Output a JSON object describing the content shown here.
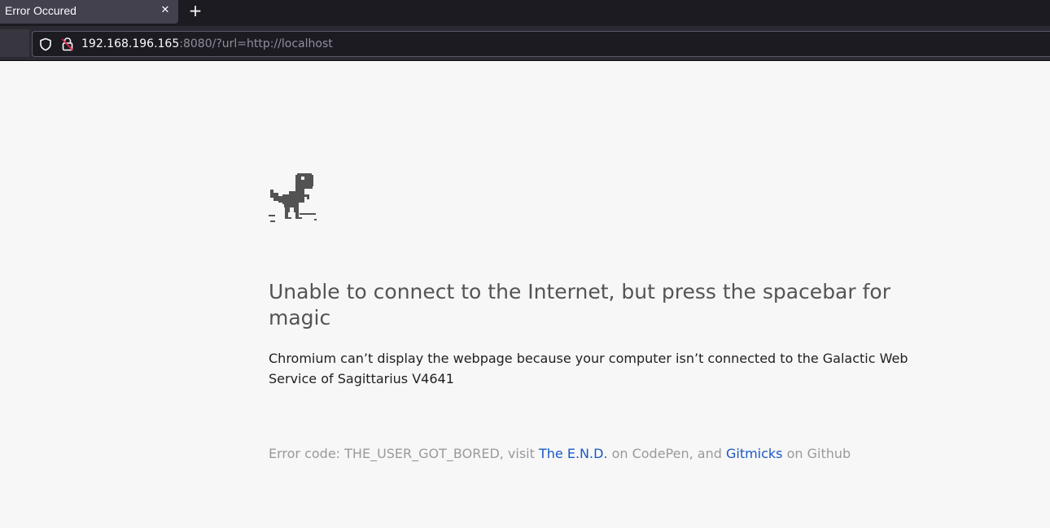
{
  "tab": {
    "title": "Error Occured",
    "close_glyph": "✕",
    "new_tab_glyph": "+"
  },
  "urlbar": {
    "host": "192.168.196.165",
    "rest": ":8080/?url=http://localhost"
  },
  "icons": {
    "shield": "shield-icon",
    "lock": "insecure-lock-icon",
    "dino": "dinosaur-icon"
  },
  "page": {
    "heading": "Unable to connect to the Internet, but press the spacebar for magic",
    "description": "Chromium can’t display the webpage because your computer isn’t connected to the Galactic Web Service of Sagittarius V4641",
    "error": {
      "prefix": "Error code: THE_USER_GOT_BORED, visit ",
      "link1": "The E.N.D.",
      "middle": " on CodePen, and ",
      "link2": "Gitmicks",
      "suffix": " on Github"
    }
  },
  "colors": {
    "tabbar_bg": "#1c1b22",
    "tab_bg": "#42414d",
    "page_bg": "#f7f7f7",
    "link": "#1a58c6",
    "heading": "#545454"
  }
}
